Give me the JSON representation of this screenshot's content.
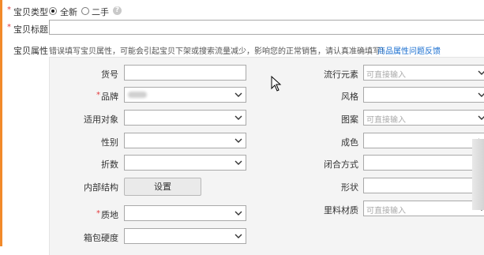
{
  "item_type": {
    "label": "宝贝类型",
    "options": [
      {
        "label": "全新",
        "selected": true
      },
      {
        "label": "二手",
        "selected": false
      }
    ]
  },
  "title_row": {
    "label": "宝贝标题",
    "value": ""
  },
  "attributes": {
    "label": "宝贝属性",
    "warning": "错误填写宝贝属性，可能会引起宝贝下架或搜索流量减少，影响您的正常销售，请认真准确填写！",
    "feedback_link": "商品属性问题反馈"
  },
  "fields_left": [
    {
      "label": "货号",
      "required": false,
      "kind": "input",
      "value": ""
    },
    {
      "label": "品牌",
      "required": true,
      "kind": "select",
      "value": ""
    },
    {
      "label": "适用对象",
      "required": false,
      "kind": "select",
      "value": ""
    },
    {
      "label": "性别",
      "required": false,
      "kind": "select",
      "value": ""
    },
    {
      "label": "折数",
      "required": false,
      "kind": "select",
      "value": ""
    },
    {
      "label": "内部结构",
      "required": false,
      "kind": "button",
      "button_label": "设置"
    },
    {
      "label": "质地",
      "required": true,
      "kind": "select",
      "value": ""
    },
    {
      "label": "箱包硬度",
      "required": false,
      "kind": "select",
      "value": ""
    }
  ],
  "fields_right": [
    {
      "label": "流行元素",
      "placeholder": "可直接输入"
    },
    {
      "label": "风格",
      "placeholder": ""
    },
    {
      "label": "图案",
      "placeholder": "可直接输入"
    },
    {
      "label": "成色",
      "placeholder": ""
    },
    {
      "label": "闭合方式",
      "placeholder": ""
    },
    {
      "label": "形状",
      "placeholder": ""
    },
    {
      "label": "里料材质",
      "placeholder": "可直接输入"
    }
  ],
  "colors": {
    "required_star": "#e4393c",
    "link": "#1a6fd0",
    "accent_bar": "#f28a2a"
  }
}
